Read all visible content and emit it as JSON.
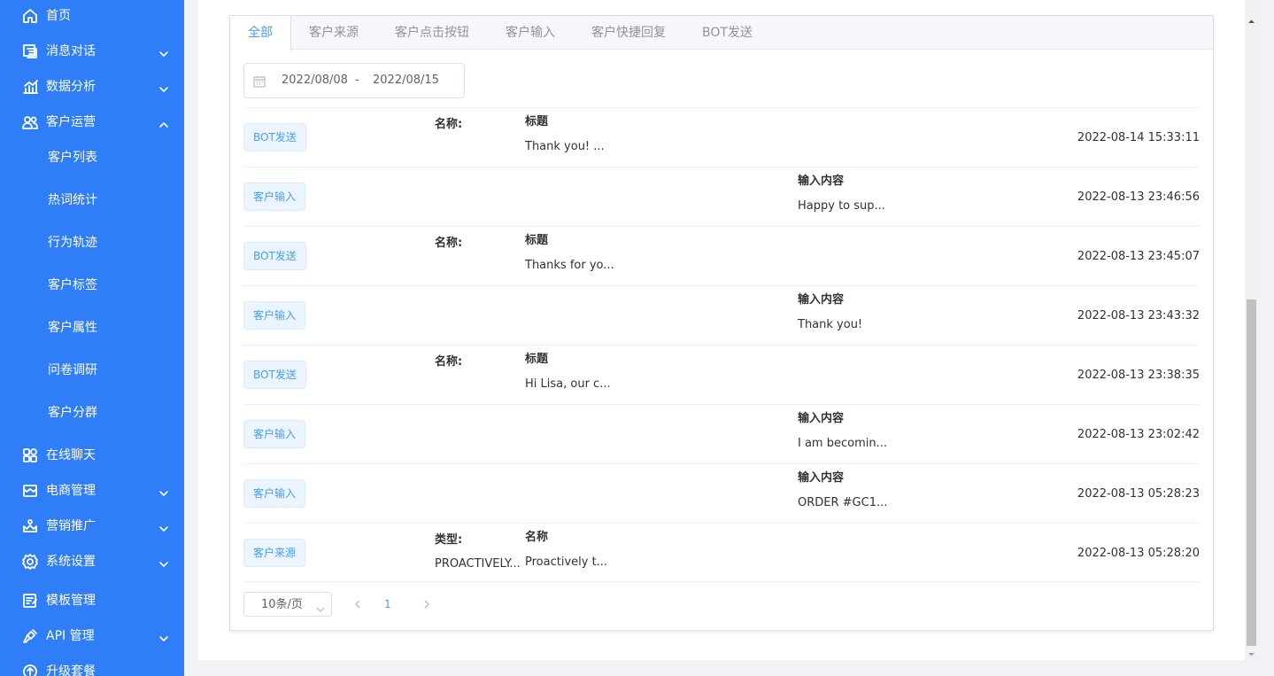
{
  "sidebar": {
    "items": [
      {
        "label": "首页",
        "icon": "home-icon",
        "chevron": "none"
      },
      {
        "label": "消息对话",
        "icon": "chat-icon",
        "chevron": "down"
      },
      {
        "label": "数据分析",
        "icon": "chart-icon",
        "chevron": "down"
      },
      {
        "label": "客户运营",
        "icon": "users-icon",
        "chevron": "up"
      },
      {
        "label": "在线聊天",
        "icon": "apps-icon",
        "chevron": "none"
      },
      {
        "label": "电商管理",
        "icon": "shop-icon",
        "chevron": "down"
      },
      {
        "label": "营销推广",
        "icon": "crown-icon",
        "chevron": "down"
      },
      {
        "label": "系统设置",
        "icon": "gear-icon",
        "chevron": "down"
      },
      {
        "label": "模板管理",
        "icon": "template-icon",
        "chevron": "none"
      },
      {
        "label": "API 管理",
        "icon": "plug-icon",
        "chevron": "down"
      },
      {
        "label": "升级套餐",
        "icon": "upgrade-icon",
        "chevron": "none"
      }
    ],
    "sub_items": [
      "客户列表",
      "热词统计",
      "行为轨迹",
      "客户标签",
      "客户属性",
      "问卷调研",
      "客户分群"
    ]
  },
  "tabs": [
    "全部",
    "客户来源",
    "客户点击按钮",
    "客户输入",
    "客户快捷回复",
    "BOT发送"
  ],
  "active_tab": "全部",
  "date_range": {
    "start": "2022/08/08",
    "separator": "-",
    "end": "2022/08/15"
  },
  "rows": [
    {
      "tag": "BOT发送",
      "label1": "名称:",
      "label2": "标题",
      "value1": "",
      "value2": "Thank you! ...",
      "label3": "",
      "value3": "",
      "time": "2022-08-14 15:33:11"
    },
    {
      "tag": "客户输入",
      "label1": "",
      "label2": "",
      "value1": "",
      "value2": "",
      "label3": "输入内容",
      "value3": "Happy to sup...",
      "time": "2022-08-13 23:46:56"
    },
    {
      "tag": "BOT发送",
      "label1": "名称:",
      "label2": "标题",
      "value1": "",
      "value2": "Thanks for yo...",
      "label3": "",
      "value3": "",
      "time": "2022-08-13 23:45:07"
    },
    {
      "tag": "客户输入",
      "label1": "",
      "label2": "",
      "value1": "",
      "value2": "",
      "label3": "输入内容",
      "value3": "Thank you!",
      "time": "2022-08-13 23:43:32"
    },
    {
      "tag": "BOT发送",
      "label1": "名称:",
      "label2": "标题",
      "value1": "",
      "value2": "Hi Lisa, our c...",
      "label3": "",
      "value3": "",
      "time": "2022-08-13 23:38:35"
    },
    {
      "tag": "客户输入",
      "label1": "",
      "label2": "",
      "value1": "",
      "value2": "",
      "label3": "输入内容",
      "value3": "I am becomin...",
      "time": "2022-08-13 23:02:42"
    },
    {
      "tag": "客户输入",
      "label1": "",
      "label2": "",
      "value1": "",
      "value2": "",
      "label3": "输入内容",
      "value3": "ORDER #GC1...",
      "time": "2022-08-13 05:28:23"
    },
    {
      "tag": "客户来源",
      "label1": "类型:",
      "label2": "名称",
      "value1": "PROACTIVELY...",
      "value2": "Proactively t...",
      "label3": "",
      "value3": "",
      "time": "2022-08-13 05:28:20"
    }
  ],
  "pagination": {
    "page_size_label": "10条/页",
    "current_page": "1"
  },
  "colors": {
    "sidebar_bg": "#2f7ef8",
    "accent": "#409eff",
    "tag_bg": "#ecf5ff"
  }
}
